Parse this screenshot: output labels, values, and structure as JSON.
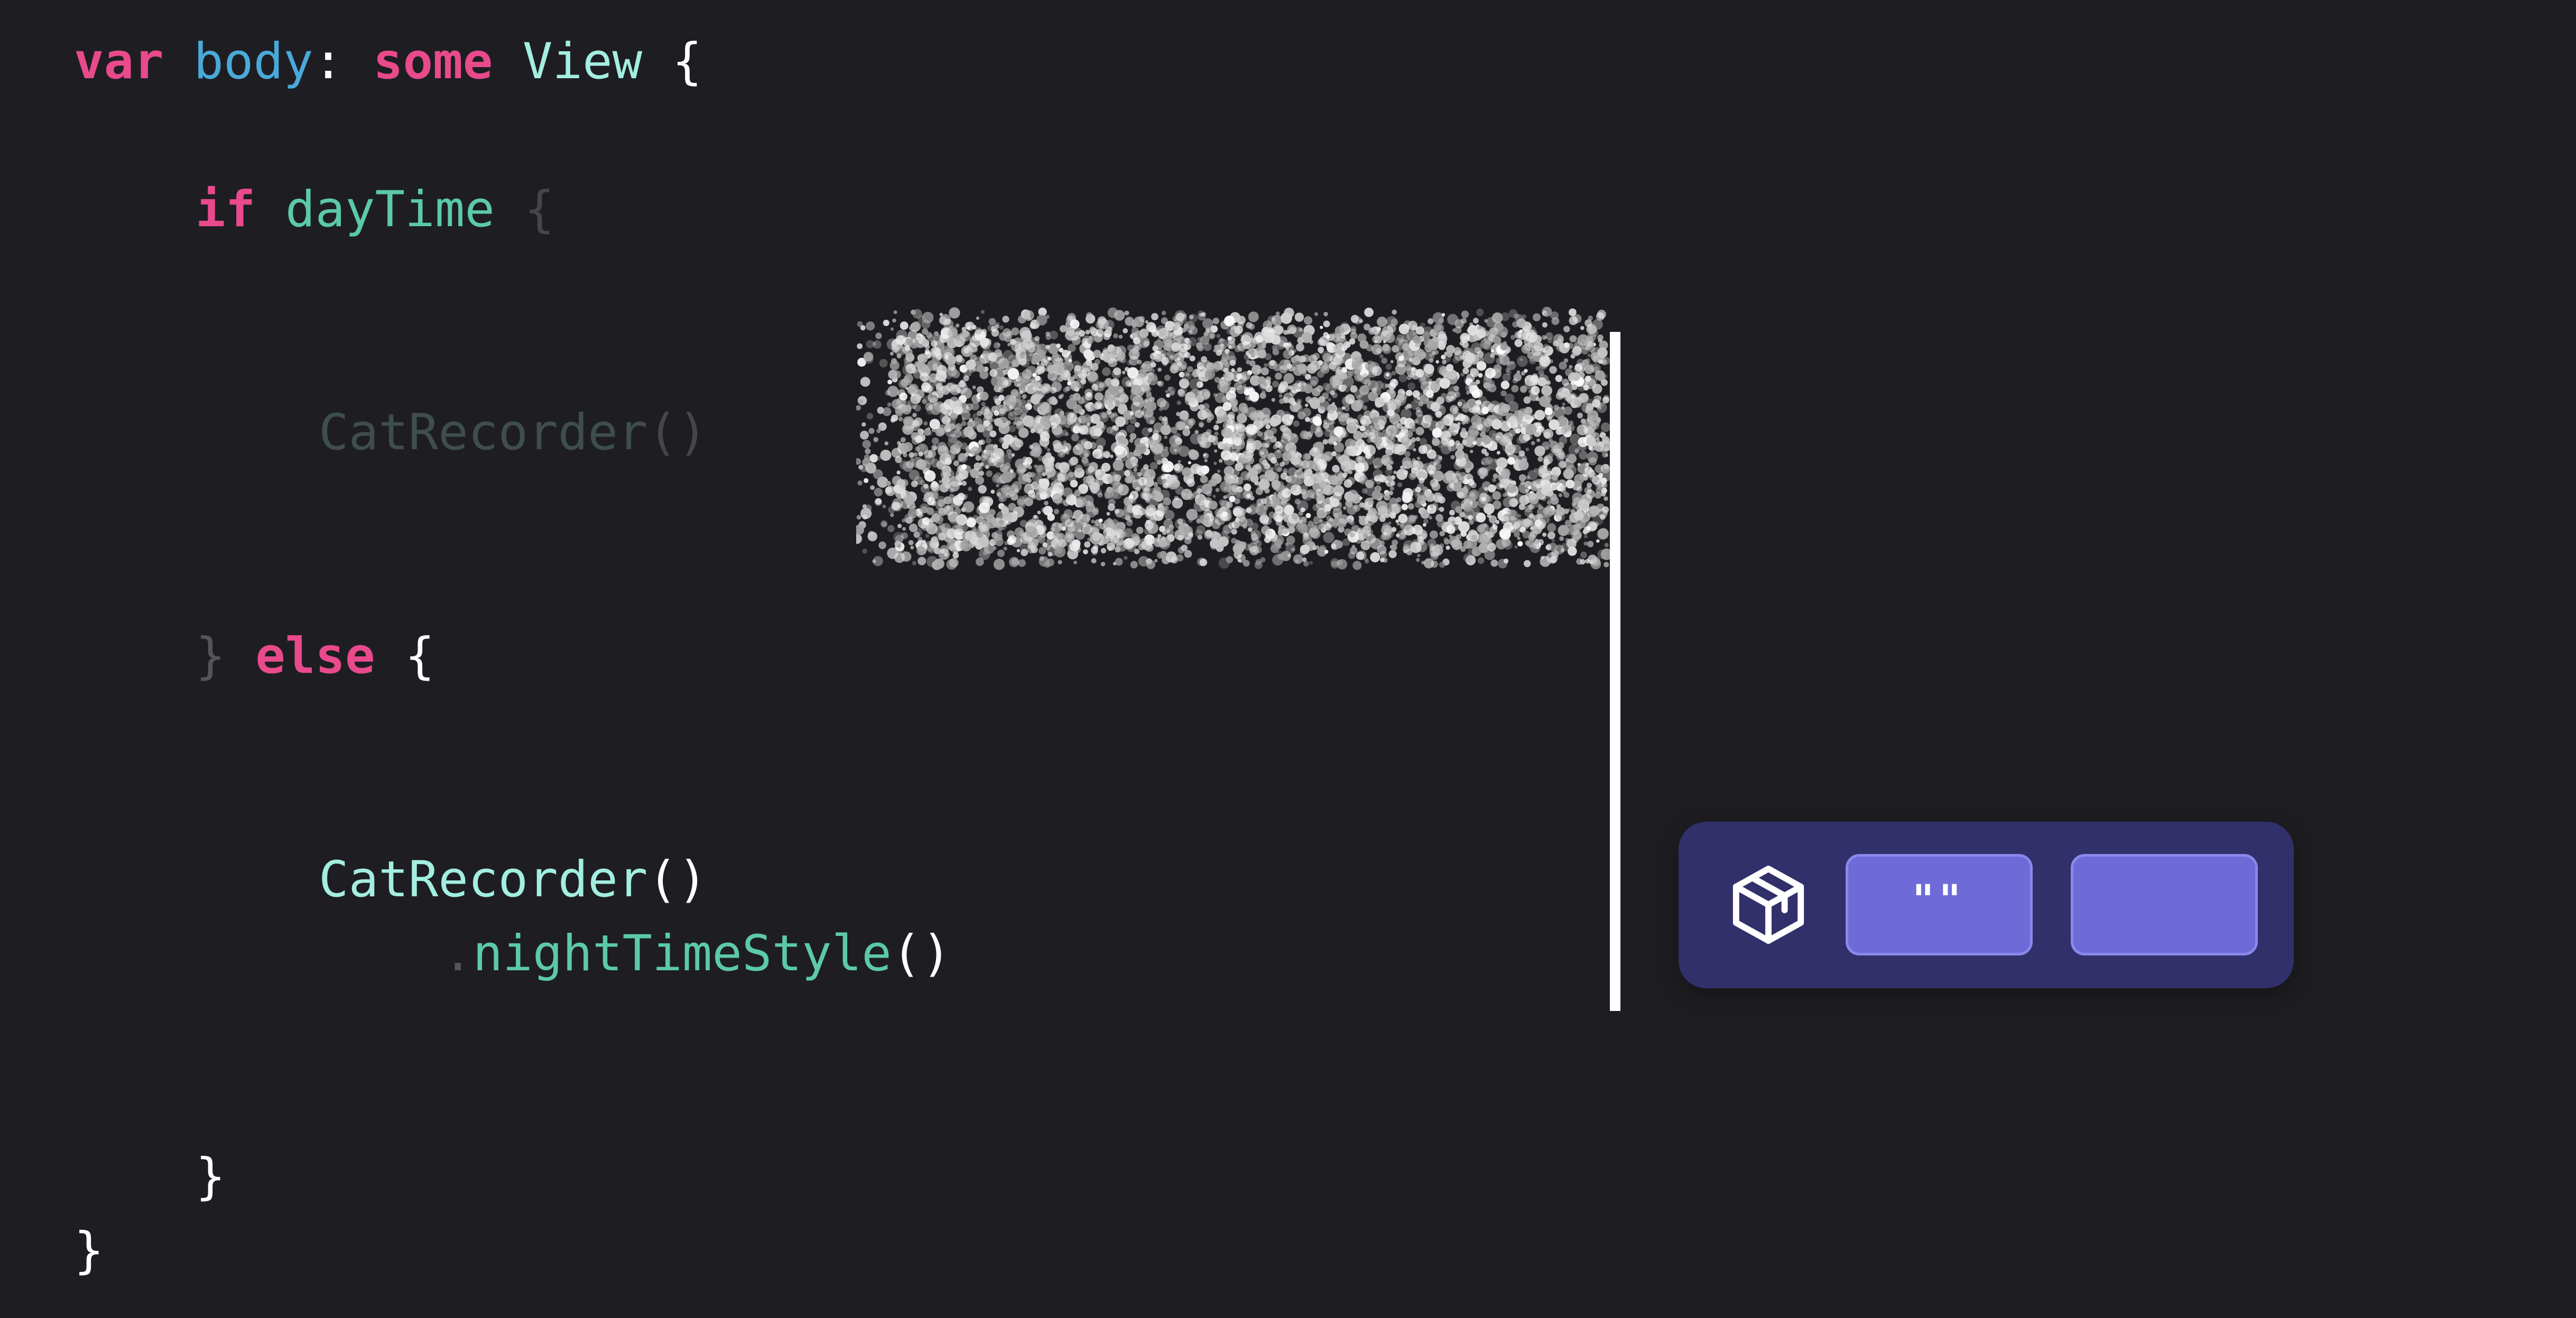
{
  "code": {
    "line1": {
      "kw_var": "var",
      "prop_body": "body",
      "colon": ":",
      "kw_some": "some",
      "type_view": "View",
      "brace": "{"
    },
    "line2": {
      "kw_if": "if",
      "cond": "dayTime",
      "brace": "{"
    },
    "line3": {
      "call": "CatRecorder",
      "parens": "()"
    },
    "line4": {
      "close_brace": "}",
      "kw_else": "else",
      "brace": "{"
    },
    "line5": {
      "call": "CatRecorder",
      "parens": "()"
    },
    "line6": {
      "dot": ".",
      "modifier": "nightTimeStyle",
      "parens": "()"
    },
    "line7": {
      "close_brace": "}"
    },
    "line8": {
      "close_brace": "}"
    }
  },
  "toolbar": {
    "icon": "package-box-icon",
    "quote_button_label": "\"\"",
    "blank_button_label": ""
  },
  "colors": {
    "background": "#1e1e22",
    "keyword": "#e84a8c",
    "property": "#4aa9d9",
    "type": "#a3eee0",
    "function": "#5cc9a7",
    "toolbar_bg": "#31306a",
    "button_bg": "#6e6bd8"
  }
}
